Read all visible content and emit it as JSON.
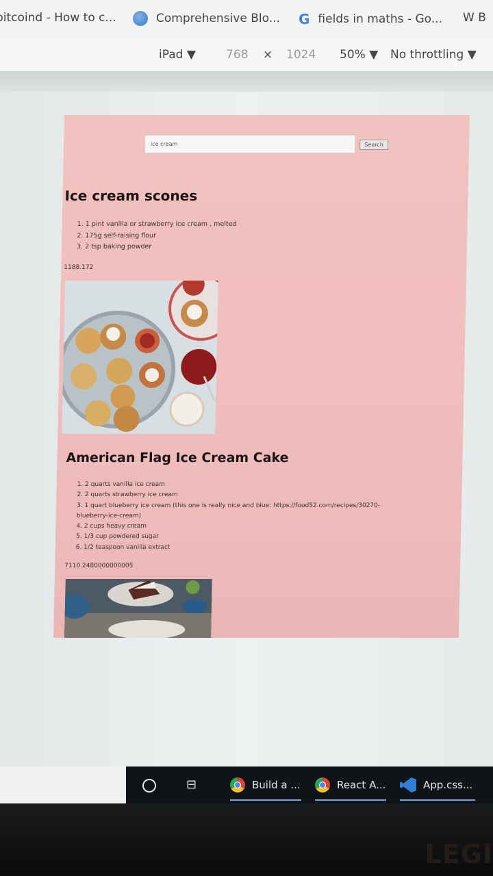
{
  "bookmarks": [
    {
      "label": "bitcoind - How to c...",
      "icon": "page-icon"
    },
    {
      "label": "Comprehensive Blo...",
      "icon": "globe-icon"
    },
    {
      "label": "fields in maths - Go...",
      "icon": "google-icon"
    },
    {
      "label": "W B",
      "icon": ""
    }
  ],
  "devtools": {
    "device": "iPad ▼",
    "width": "768",
    "times": "×",
    "height": "1024",
    "zoom": "50% ▼",
    "throttle": "No throttling ▼"
  },
  "page": {
    "search": {
      "value": "ice cream",
      "button": "Search"
    },
    "recipes": [
      {
        "title": "Ice cream scones",
        "ingredients": [
          "1. 1 pint vanilla or strawberry ice cream , melted",
          "2. 175g self-raising flour",
          "3. 2 tsp baking powder"
        ],
        "calories": "1188.172"
      },
      {
        "title": "American Flag Ice Cream Cake",
        "ingredients": [
          "1. 2 quarts vanilla ice cream",
          "2. 2 quarts strawberry ice cream",
          "3. 1 quart blueberry ice cream (this one is really nice and blue: https://food52.com/recipes/30270-",
          "   blueberry-ice-cream)",
          "4. 2 cups heavy cream",
          "5. 1/3 cup powdered sugar",
          "6. 1/2 teaspoon vanilla extract"
        ],
        "calories": "7110.2480000000005"
      }
    ]
  },
  "taskbar": {
    "items": [
      "Build a ...",
      "React A...",
      "App.css..."
    ]
  },
  "monitor": {
    "brand": "LEGI"
  },
  "colors": {
    "page_bg": "#efbdbd",
    "viewport_bg": "#e9eded",
    "taskbar_bg": "#101418"
  }
}
